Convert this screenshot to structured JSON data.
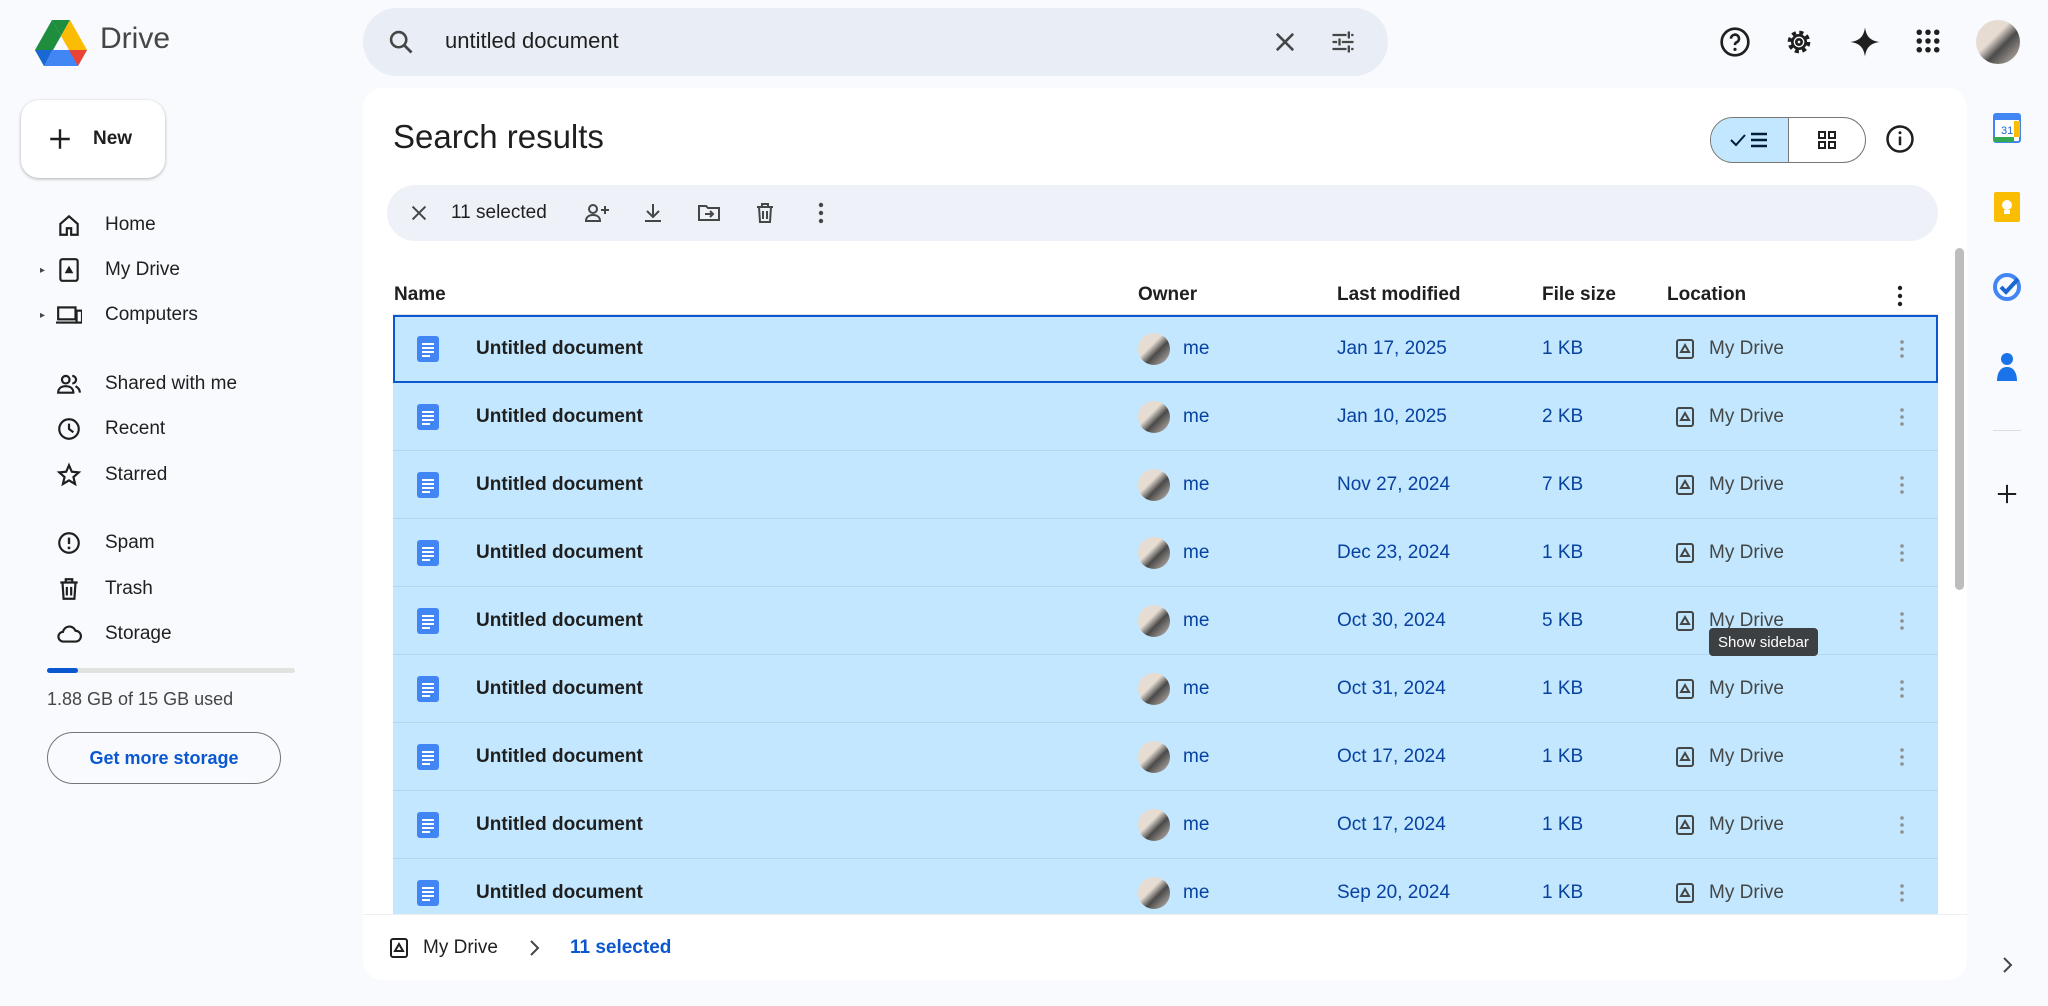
{
  "app": {
    "name": "Drive"
  },
  "search": {
    "query": "untitled document"
  },
  "sidebar": {
    "new_label": "New",
    "items": [
      {
        "label": "Home",
        "icon": "home-icon",
        "caret": false
      },
      {
        "label": "My Drive",
        "icon": "my-drive-icon",
        "caret": true
      },
      {
        "label": "Computers",
        "icon": "computers-icon",
        "caret": true
      },
      {
        "label": "Shared with me",
        "icon": "shared-icon",
        "caret": false
      },
      {
        "label": "Recent",
        "icon": "clock-icon",
        "caret": false
      },
      {
        "label": "Starred",
        "icon": "star-icon",
        "caret": false
      },
      {
        "label": "Spam",
        "icon": "spam-icon",
        "caret": false
      },
      {
        "label": "Trash",
        "icon": "trash-icon",
        "caret": false
      },
      {
        "label": "Storage",
        "icon": "cloud-icon",
        "caret": false
      }
    ],
    "storage": {
      "text": "1.88 GB of 15 GB used",
      "used_fraction": 0.125,
      "button": "Get more storage"
    }
  },
  "main": {
    "title": "Search results",
    "selection": {
      "count_label": "11 selected"
    },
    "columns": [
      "Name",
      "Owner",
      "Last modified",
      "File size",
      "Location"
    ],
    "rows": [
      {
        "name": "Untitled document",
        "owner": "me",
        "modified": "Jan 17, 2025",
        "size": "1 KB",
        "location": "My Drive"
      },
      {
        "name": "Untitled document",
        "owner": "me",
        "modified": "Jan 10, 2025",
        "size": "2 KB",
        "location": "My Drive"
      },
      {
        "name": "Untitled document",
        "owner": "me",
        "modified": "Nov 27, 2024",
        "size": "7 KB",
        "location": "My Drive"
      },
      {
        "name": "Untitled document",
        "owner": "me",
        "modified": "Dec 23, 2024",
        "size": "1 KB",
        "location": "My Drive"
      },
      {
        "name": "Untitled document",
        "owner": "me",
        "modified": "Oct 30, 2024",
        "size": "5 KB",
        "location": "My Drive"
      },
      {
        "name": "Untitled document",
        "owner": "me",
        "modified": "Oct 31, 2024",
        "size": "1 KB",
        "location": "My Drive"
      },
      {
        "name": "Untitled document",
        "owner": "me",
        "modified": "Oct 17, 2024",
        "size": "1 KB",
        "location": "My Drive"
      },
      {
        "name": "Untitled document",
        "owner": "me",
        "modified": "Oct 17, 2024",
        "size": "1 KB",
        "location": "My Drive"
      },
      {
        "name": "Untitled document",
        "owner": "me",
        "modified": "Sep 20, 2024",
        "size": "1 KB",
        "location": "My Drive"
      }
    ],
    "footer": {
      "root": "My Drive",
      "current": "11 selected"
    },
    "tooltip": "Show sidebar"
  },
  "colors": {
    "accent": "#0b57d0",
    "selected_row": "#c2e7ff",
    "doc_icon": "#4285f4"
  }
}
